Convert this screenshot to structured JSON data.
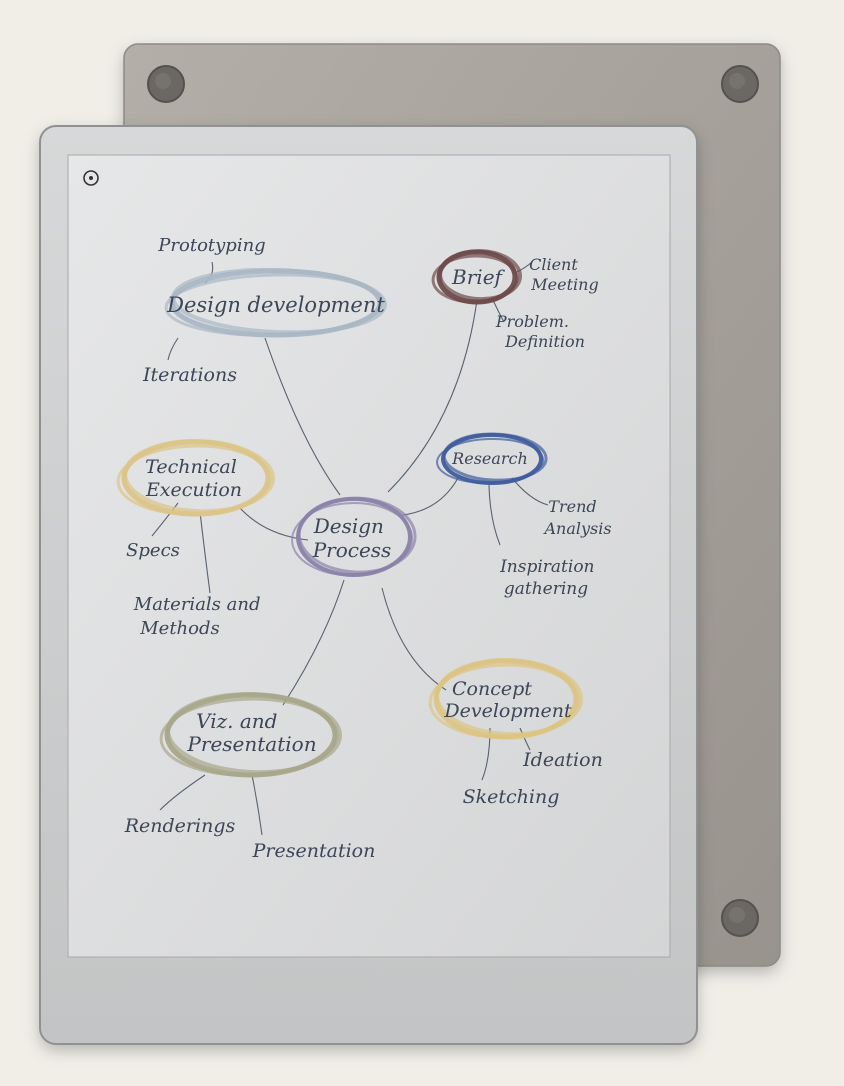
{
  "device": {
    "back_cover_color": "#a39e98",
    "front_frame_color": "#c9cbcc",
    "screen_color": "#e2e3e4",
    "magnet_color": "#5f5b58"
  },
  "mindmap": {
    "ink_color": "#3c4657",
    "nodes": [
      {
        "id": "center",
        "lines": [
          "Design",
          "Process"
        ],
        "ring_color": "#8a82a8"
      },
      {
        "id": "design_dev",
        "lines": [
          "Design development"
        ],
        "ring_color": "#a9b8c5"
      },
      {
        "id": "brief",
        "lines": [
          "Brief"
        ],
        "ring_color": "#6e4b4b"
      },
      {
        "id": "research",
        "lines": [
          "Research"
        ],
        "ring_color": "#3f5d9c"
      },
      {
        "id": "tech",
        "lines": [
          "Technical",
          "Execution"
        ],
        "ring_color": "#dcc488"
      },
      {
        "id": "concept",
        "lines": [
          "Concept",
          "Development"
        ],
        "ring_color": "#dcc583"
      },
      {
        "id": "viz",
        "lines": [
          "Viz. and",
          "Presentation"
        ],
        "ring_color": "#a8a78a"
      }
    ],
    "leaves": [
      {
        "id": "prototyping",
        "lines": [
          "Prototyping"
        ]
      },
      {
        "id": "iterations",
        "lines": [
          "Iterations"
        ]
      },
      {
        "id": "client_meeting",
        "lines": [
          "Client",
          "Meeting"
        ]
      },
      {
        "id": "problem_def",
        "lines": [
          "Problem.",
          "Definition"
        ]
      },
      {
        "id": "trend",
        "lines": [
          "Trend",
          "Analysis"
        ]
      },
      {
        "id": "inspiration",
        "lines": [
          "Inspiration",
          "gathering"
        ]
      },
      {
        "id": "specs",
        "lines": [
          "Specs"
        ]
      },
      {
        "id": "materials",
        "lines": [
          "Materials and",
          "Methods"
        ]
      },
      {
        "id": "ideation",
        "lines": [
          "Ideation"
        ]
      },
      {
        "id": "sketching",
        "lines": [
          "Sketching"
        ]
      },
      {
        "id": "renderings",
        "lines": [
          "Renderings"
        ]
      },
      {
        "id": "presentation",
        "lines": [
          "Presentation"
        ]
      }
    ]
  }
}
